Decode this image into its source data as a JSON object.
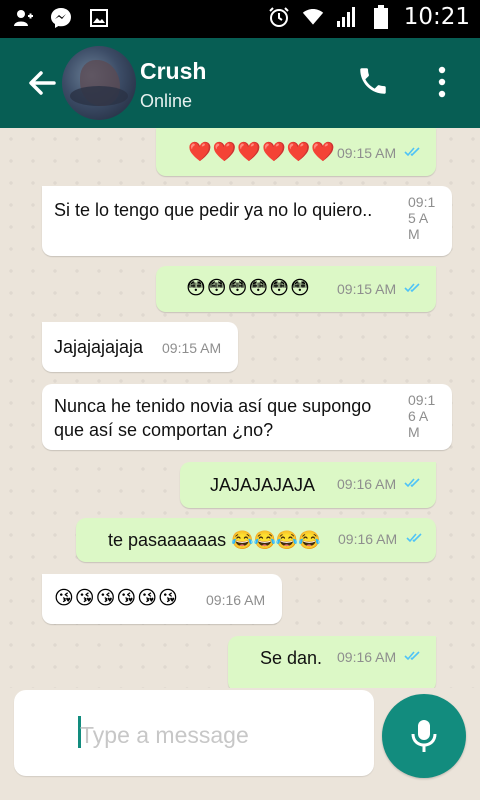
{
  "status_bar": {
    "time": "10:21"
  },
  "header": {
    "contact_name": "Crush",
    "contact_status": "Online"
  },
  "messages": [
    {
      "direction": "out",
      "text": "❤️❤️❤️❤️❤️❤️",
      "time": "09:15 AM",
      "read": true
    },
    {
      "direction": "in",
      "text": "Si te lo tengo que pedir ya no lo quiero..",
      "time": "09:15 AM"
    },
    {
      "direction": "out",
      "text": "😳😳😳😳😳😳",
      "time": "09:15 AM",
      "read": true
    },
    {
      "direction": "in",
      "text": "Jajajajajaja",
      "time": "09:15 AM"
    },
    {
      "direction": "in",
      "text": "Nunca he tenido novia así que supongo que así se comportan ¿no?",
      "time": "09:16 AM"
    },
    {
      "direction": "out",
      "text": "JAJAJAJAJA",
      "time": "09:16 AM",
      "read": true
    },
    {
      "direction": "out",
      "text": "te pasaaaaaas 😂😂😂😂",
      "time": "09:16 AM",
      "read": true
    },
    {
      "direction": "in",
      "text": "😘😘😘😘😘😘",
      "time": "09:16 AM"
    },
    {
      "direction": "out",
      "text": "Se dan.",
      "time": "09:16 AM",
      "read": true
    }
  ],
  "composer": {
    "placeholder": "Type a message"
  },
  "colors": {
    "header": "#075e54",
    "accent": "#128c7e",
    "outgoing_bubble": "#dcf8c6",
    "incoming_bubble": "#ffffff",
    "read_ticks": "#4fc3f7"
  }
}
